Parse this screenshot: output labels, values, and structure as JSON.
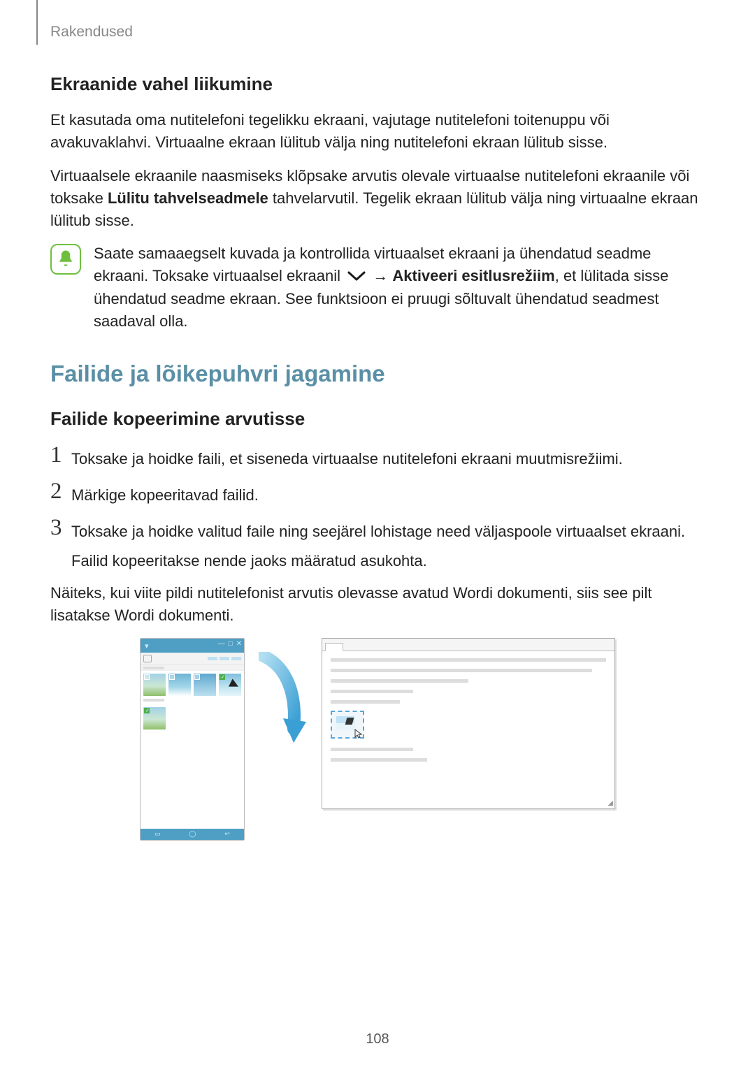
{
  "header": {
    "breadcrumb": "Rakendused"
  },
  "sec1": {
    "heading": "Ekraanide vahel liikumine",
    "p1": "Et kasutada oma nutitelefoni tegelikku ekraani, vajutage nutitelefoni toitenuppu või avakuvaklahvi. Virtuaalne ekraan lülitub välja ning nutitelefoni ekraan lülitub sisse.",
    "p2a": "Virtuaalsele ekraanile naasmiseks klõpsake arvutis olevale virtuaalse nutitelefoni ekraanile või toksake ",
    "p2b_bold": "Lülitu tahvelseadmele",
    "p2c": " tahvelarvutil. Tegelik ekraan lülitub välja ning virtuaalne ekraan lülitub sisse."
  },
  "note": {
    "t1": "Saate samaaegselt kuvada ja kontrollida virtuaalset ekraani ja ühendatud seadme ekraani. Toksake virtuaalsel ekraanil ",
    "arrow": "→",
    "t2_bold": "Aktiveeri esitlusrežiim",
    "t3": ", et lülitada sisse ühendatud seadme ekraan. See funktsioon ei pruugi sõltuvalt ühendatud seadmest saadaval olla."
  },
  "sec2": {
    "heading": "Failide ja lõikepuhvri jagamine",
    "subheading": "Failide kopeerimine arvutisse",
    "steps": {
      "1": "Toksake ja hoidke faili, et siseneda virtuaalse nutitelefoni ekraani muutmisrežiimi.",
      "2": "Märkige kopeeritavad failid.",
      "3": "Toksake ja hoidke valitud faile ning seejärel lohistage need väljaspoole virtuaalset ekraani.",
      "3sub": "Failid kopeeritakse nende jaoks määratud asukohta."
    },
    "after": "Näiteks, kui viite pildi nutitelefonist arvutis olevasse avatud Wordi dokumenti, siis see pilt lisatakse Wordi dokumenti."
  },
  "page_number": "108",
  "step_nums": {
    "one": "1",
    "two": "2",
    "three": "3"
  }
}
